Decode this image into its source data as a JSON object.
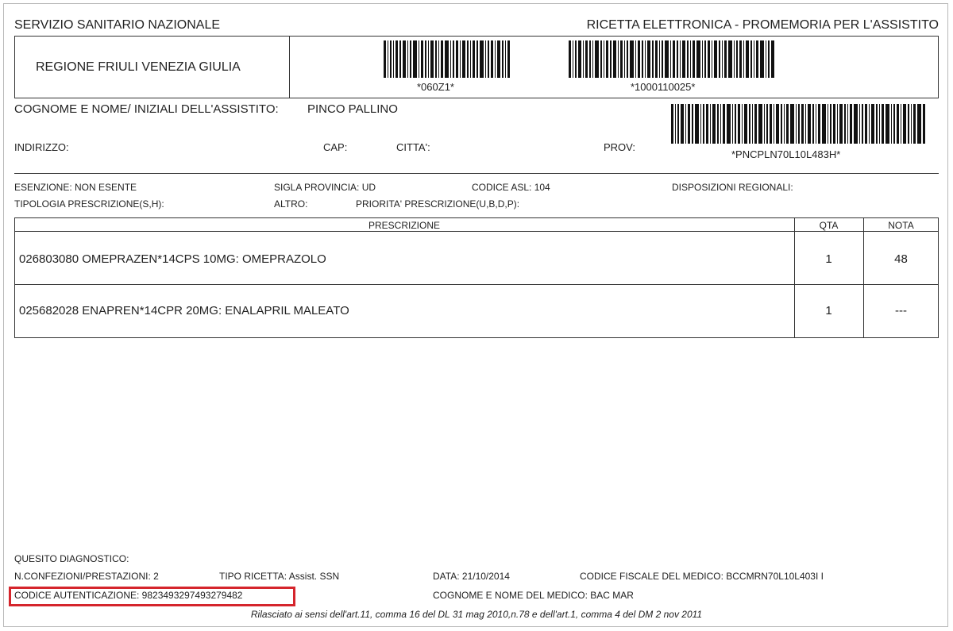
{
  "header": {
    "left_title": "SERVIZIO SANITARIO NAZIONALE",
    "right_title": "RICETTA ELETTRONICA - PROMEMORIA PER L'ASSISTITO"
  },
  "region": "REGIONE FRIULI VENEZIA GIULIA",
  "barcodes": {
    "code1": "*060Z1*",
    "code2": "*1000110025*",
    "code3": "*PNCPLN70L10L483H*"
  },
  "patient": {
    "name_label": "COGNOME E NOME/ INIZIALI DELL'ASSISTITO:",
    "name_value": "PINCO PALLINO",
    "address_label": "INDIRIZZO:",
    "cap_label": "CAP:",
    "city_label": "CITTA':",
    "prov_label": "PROV:"
  },
  "info": {
    "esenzione": "ESENZIONE: NON ESENTE",
    "sigla": "SIGLA PROVINCIA: UD",
    "asl": "CODICE ASL: 104",
    "disposizioni": "DISPOSIZIONI REGIONALI:",
    "tipologia": "TIPOLOGIA PRESCRIZIONE(S,H):",
    "altro": "ALTRO:",
    "priorita": "PRIORITA' PRESCRIZIONE(U,B,D,P):"
  },
  "table": {
    "headers": [
      "PRESCRIZIONE",
      "QTA",
      "NOTA"
    ],
    "rows": [
      {
        "prescrizione": "026803080 OMEPRAZEN*14CPS 10MG: OMEPRAZOLO",
        "qta": "1",
        "nota": "48"
      },
      {
        "prescrizione": "025682028 ENAPREN*14CPR 20MG: ENALAPRIL MALEATO",
        "qta": "1",
        "nota": "---"
      }
    ]
  },
  "footer": {
    "quesito": "QUESITO DIAGNOSTICO:",
    "confezioni": "N.CONFEZIONI/PRESTAZIONI: 2",
    "tipo_ricetta": "TIPO RICETTA: Assist. SSN",
    "data": "DATA: 21/10/2014",
    "cf_medico": "CODICE FISCALE DEL MEDICO: BCCMRN70L10L403I I",
    "autenticazione": "CODICE AUTENTICAZIONE: 9823493297493279482",
    "medico": "COGNOME E NOME DEL MEDICO: BAC MAR",
    "note": "Rilasciato ai sensi dell'art.11, comma 16 del DL 31 mag 2010,n.78 e dell'art.1, comma 4 del DM 2 nov 2011"
  },
  "colors": {
    "highlight": "#d5252c",
    "text": "#222222"
  }
}
